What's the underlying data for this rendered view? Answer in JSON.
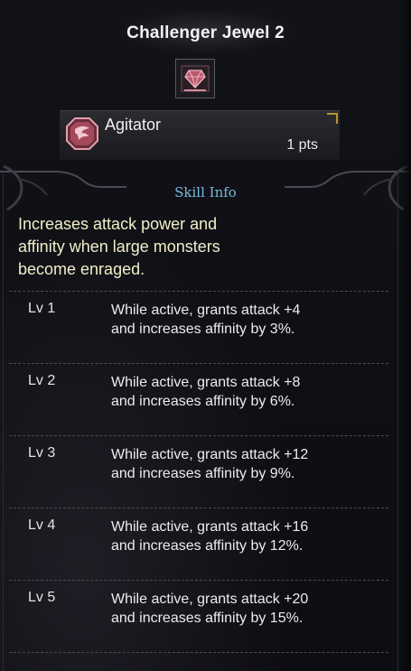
{
  "header": {
    "title": "Challenger Jewel 2",
    "jewel_icon": "jewel-icon"
  },
  "skill": {
    "name": "Agitator",
    "points": "1 pts",
    "icon": "skill-emblem-icon"
  },
  "info": {
    "section_label": "Skill Info",
    "description_lines": [
      "Increases attack power and",
      "affinity when large monsters",
      "become enraged."
    ]
  },
  "levels": [
    {
      "label": "Lv 1",
      "line1": "While active, grants attack +4",
      "line2": "and increases affinity by 3%."
    },
    {
      "label": "Lv 2",
      "line1": "While active, grants attack +8",
      "line2": "and increases affinity by 6%."
    },
    {
      "label": "Lv 3",
      "line1": "While active, grants attack +12",
      "line2": "and increases affinity by 9%."
    },
    {
      "label": "Lv 4",
      "line1": "While active, grants attack +16",
      "line2": "and increases affinity by 12%."
    },
    {
      "label": "Lv 5",
      "line1": "While active, grants attack +20",
      "line2": "and increases affinity by 15%."
    }
  ],
  "colors": {
    "description_text": "#f2edc9",
    "section_label": "#79b9dc",
    "jewel_accent": "#c76a7c",
    "bar_corner_accent": "#b8952e"
  }
}
